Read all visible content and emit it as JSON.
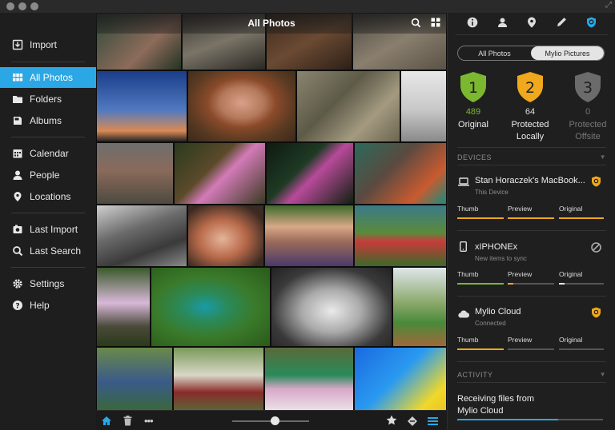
{
  "window": {
    "title": "All Photos"
  },
  "sidebar": {
    "items": [
      {
        "label": "Import",
        "icon": "import-icon"
      },
      {
        "label": "All Photos",
        "icon": "grid-icon",
        "active": true
      },
      {
        "label": "Folders",
        "icon": "folder-icon"
      },
      {
        "label": "Albums",
        "icon": "album-icon"
      },
      {
        "label": "Calendar",
        "icon": "calendar-icon"
      },
      {
        "label": "People",
        "icon": "person-icon"
      },
      {
        "label": "Locations",
        "icon": "location-pin-icon"
      },
      {
        "label": "Last Import",
        "icon": "last-import-icon"
      },
      {
        "label": "Last Search",
        "icon": "search-icon"
      },
      {
        "label": "Settings",
        "icon": "gear-icon"
      },
      {
        "label": "Help",
        "icon": "help-icon"
      }
    ]
  },
  "grid": {
    "title": "All Photos"
  },
  "panel": {
    "tabs": [
      "All Photos",
      "Mylio Pictures"
    ],
    "active_tab": "Mylio Pictures",
    "protection": [
      {
        "level": "1",
        "count": "489",
        "label": "Original",
        "color": "#7cb82f"
      },
      {
        "level": "2",
        "count": "64",
        "label": "Protected\nLocally",
        "color": "#f0a81c"
      },
      {
        "level": "3",
        "count": "0",
        "label": "Protected\nOffsite",
        "color": "#6b6b6b"
      }
    ],
    "devices_header": "DEVICES",
    "devices": [
      {
        "name": "Stan Horaczek's MacBook...",
        "sub": "This Device",
        "icon": "laptop-icon",
        "badge": "shield-badge-icon",
        "columns": [
          "Thumb",
          "Preview",
          "Original"
        ],
        "fills": [
          1.0,
          1.0,
          1.0
        ],
        "colors": [
          "#f0a81c",
          "#f0a81c",
          "#f0a81c"
        ]
      },
      {
        "name": "xIPHONEx",
        "sub": "New items to sync",
        "icon": "phone-icon",
        "badge": "no-sync-icon",
        "columns": [
          "Thumb",
          "Preview",
          "Original"
        ],
        "fills": [
          1.0,
          0.12,
          0.12
        ],
        "colors": [
          "#7cb82f",
          "#f0a81c",
          "#e6e6e6"
        ]
      },
      {
        "name": "Mylio Cloud",
        "sub": "Connected",
        "icon": "cloud-icon",
        "badge": "shield-badge-icon",
        "columns": [
          "Thumb",
          "Preview",
          "Original"
        ],
        "fills": [
          1.0,
          0.0,
          0.0
        ],
        "colors": [
          "#f0a81c",
          "#999999",
          "#999999"
        ]
      }
    ],
    "activity_header": "ACTIVITY",
    "activity_text": "Receiving files from\nMylio Cloud",
    "activity_progress": 0.69
  }
}
